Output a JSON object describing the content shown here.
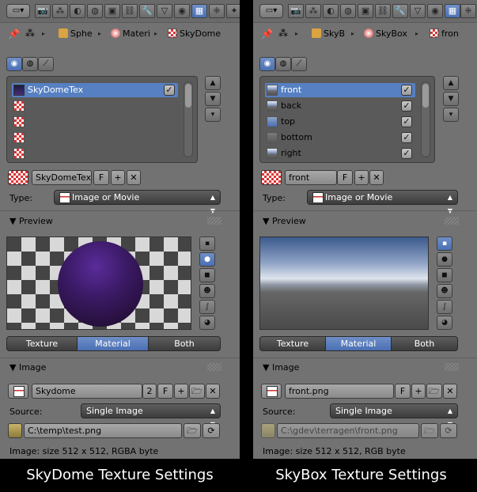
{
  "left": {
    "breadcrumb": [
      "Sphe",
      "Materi",
      "SkyDome"
    ],
    "slots": [
      {
        "label": "SkyDomeTex",
        "checked": true,
        "selected": true
      },
      {
        "label": ""
      },
      {
        "label": ""
      },
      {
        "label": ""
      },
      {
        "label": ""
      }
    ],
    "texture_name": "SkyDomeTex",
    "fake_user": "F",
    "type_label": "Type:",
    "type_value": "Image or Movie",
    "preview_header": "Preview",
    "preview_tabs": [
      "Texture",
      "Material",
      "Both"
    ],
    "preview_selected": "Material",
    "image_header": "Image",
    "image_name": "Skydome",
    "image_users": "2",
    "image_fake": "F",
    "source_label": "Source:",
    "source_value": "Single Image",
    "path": "C:\\temp\\test.png",
    "info": "Image: size 512 x 512, RGBA byte"
  },
  "right": {
    "breadcrumb": [
      "SkyB",
      "SkyBox",
      "fron"
    ],
    "slots": [
      {
        "label": "front",
        "checked": true,
        "selected": true
      },
      {
        "label": "back",
        "checked": true
      },
      {
        "label": "top",
        "checked": true
      },
      {
        "label": "bottom",
        "checked": true
      },
      {
        "label": "right",
        "checked": true
      }
    ],
    "texture_name": "front",
    "fake_user": "F",
    "type_label": "Type:",
    "type_value": "Image or Movie",
    "preview_header": "Preview",
    "preview_tabs": [
      "Texture",
      "Material",
      "Both"
    ],
    "preview_selected": "Material",
    "image_header": "Image",
    "image_name": "front.png",
    "image_fake": "F",
    "source_label": "Source:",
    "source_value": "Single Image",
    "path": "C:\\gdev\\terragen\\front.png",
    "info": "Image: size 512 x 512, RGB byte"
  },
  "captions": {
    "left": "SkyDome Texture Settings",
    "right": "SkyBox Texture Settings"
  },
  "colors": {
    "selection": "#5680c2",
    "panel_bg": "#727272"
  }
}
